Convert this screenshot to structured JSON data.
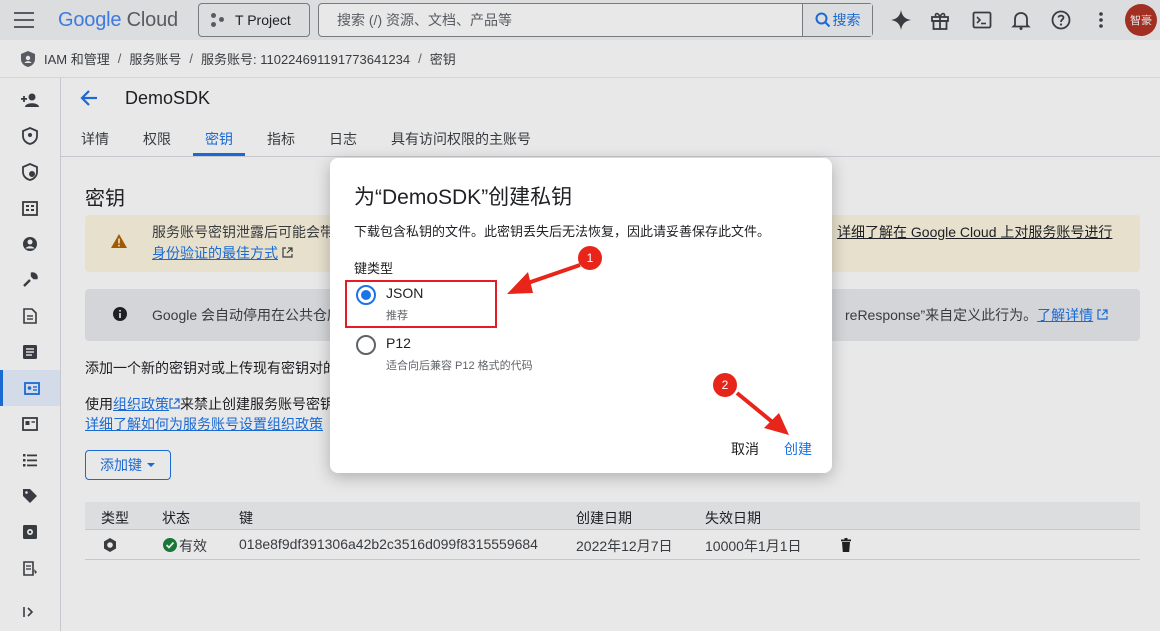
{
  "topbar": {
    "logo_google": "Google",
    "logo_cloud": "Cloud",
    "project": "T Project",
    "search_placeholder": "搜索 (/) 资源、文档、产品等",
    "search_button": "搜索",
    "avatar_text": "智豪"
  },
  "breadcrumb": {
    "items": [
      "IAM 和管理",
      "服务账号",
      "服务账号: 110224691191773641234",
      "密钥"
    ]
  },
  "page": {
    "title": "DemoSDK",
    "tabs": [
      "详情",
      "权限",
      "密钥",
      "指标",
      "日志",
      "具有访问权限的主账号"
    ],
    "section_title": "密钥",
    "warning_text": "服务账号密钥泄露后可能会带",
    "warning_link1": "详细了解在 Google Cloud 上对服务账号进行",
    "warning_link2": "身份验证的最佳方式",
    "info_text": "Google 会自动停用在公共仓库",
    "info_text2": "reResponse”来自定义此行为。",
    "info_link": "了解详情",
    "para1": "添加一个新的密钥对或上传现有密钥对的",
    "para2_prefix": "使用",
    "para2_link": "组织政策",
    "para2_suffix": "来禁止创建服务账号密钥",
    "para3_link": "详细了解如何为服务账号设置组织政策",
    "add_key": "添加键"
  },
  "table": {
    "headers": [
      "类型",
      "状态",
      "键",
      "创建日期",
      "失效日期"
    ],
    "rows": [
      {
        "status": "有效",
        "key": "018e8f9df391306a42b2c3516d099f8315559684",
        "created": "2022年12月7日",
        "expires": "10000年1月1日"
      }
    ]
  },
  "dialog": {
    "title": "为“DemoSDK”创建私钥",
    "description": "下载包含私钥的文件。此密钥丢失后无法恢复，因此请妥善保存此文件。",
    "key_type_label": "键类型",
    "options": [
      {
        "label": "JSON",
        "sublabel": "推荐",
        "selected": true
      },
      {
        "label": "P12",
        "sublabel": "适合向后兼容 P12 格式的代码",
        "selected": false
      }
    ],
    "cancel": "取消",
    "create": "创建"
  },
  "annotations": {
    "badge1": "1",
    "badge2": "2",
    "color": "#e8251a"
  }
}
